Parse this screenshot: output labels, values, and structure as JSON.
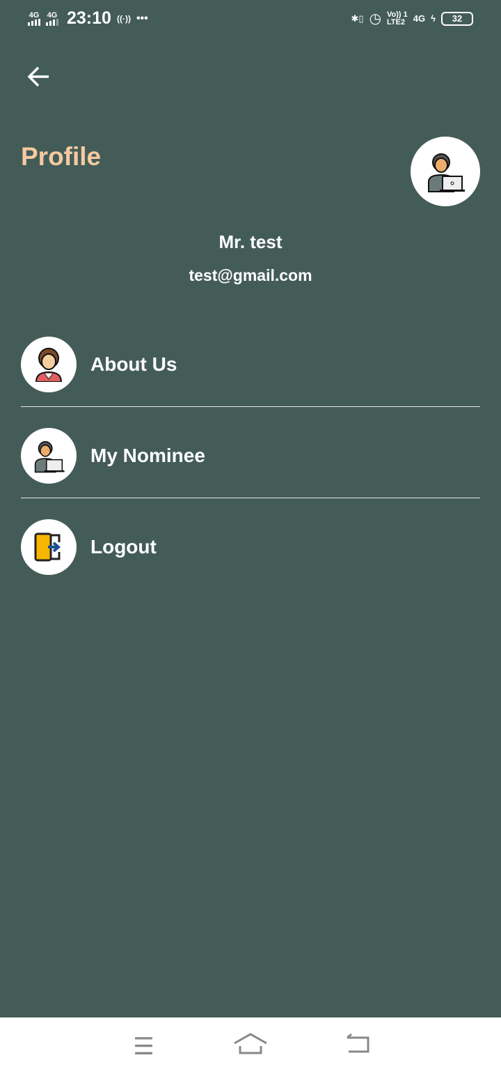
{
  "status_bar": {
    "sim1": "4G",
    "sim2": "4G",
    "time": "23:10",
    "volte": "Vo)) 1",
    "lte": "LTE2",
    "network": "4G",
    "battery": "32"
  },
  "header": {
    "title": "Profile",
    "back_icon": "arrow-left-icon"
  },
  "user": {
    "name": "Mr. test",
    "email": "test@gmail.com"
  },
  "menu": [
    {
      "label": "About Us",
      "icon": "woman-avatar-icon"
    },
    {
      "label": "My Nominee",
      "icon": "man-laptop-icon"
    },
    {
      "label": "Logout",
      "icon": "logout-door-icon"
    }
  ],
  "colors": {
    "background": "#445c58",
    "title": "#f6c9a0"
  }
}
